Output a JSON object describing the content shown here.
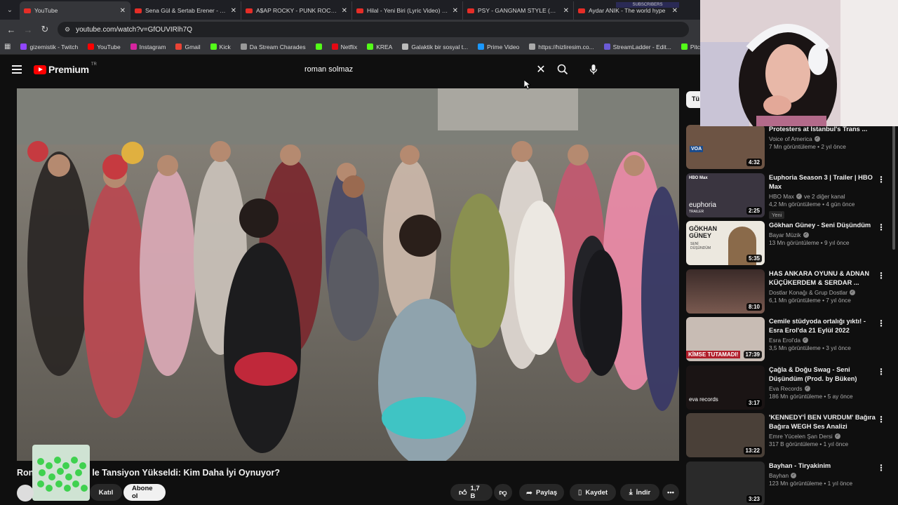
{
  "browser": {
    "tabs": [
      {
        "title": "YouTube",
        "active": true
      },
      {
        "title": "Sena Gül & Sertab Erener - Yed"
      },
      {
        "title": "A$AP ROCKY - PUNK ROCKY (V"
      },
      {
        "title": "Hilal - Yeni Biri (Lyric Video) - Y"
      },
      {
        "title": "PSY - GANGNAM STYLE (강남스"
      },
      {
        "title": "Aydar ANIK - The world hype"
      }
    ],
    "overlay_text": "SUBSCRIBERS",
    "url": "youtube.com/watch?v=GfOUVIRlh7Q",
    "bookmarks": [
      "gizemistik - Twitch",
      "YouTube",
      "Instagram",
      "Gmail",
      "Kick",
      "Da Stream Charades",
      "",
      "Netflix",
      "KREA",
      "Galaktik bir sosyal t...",
      "Prime Video",
      "https://hizliresim.co...",
      "StreamLadder - Edit...",
      "Pitch KICK"
    ]
  },
  "header": {
    "logo": "Premium",
    "logo_region": "TR",
    "search_query": "roman solmaz"
  },
  "video": {
    "title_visible_start": "Ron",
    "title_visible_end": "le Tansiyon Yükseldi: Kim Daha İyi Oynuyor?",
    "join_label": "Katıl",
    "subscribe_label": "Abone ol",
    "likes": "1,7 B",
    "share_label": "Paylaş",
    "save_label": "Kaydet",
    "download_label": "İndir"
  },
  "sidebar": {
    "chip": "Tü",
    "items": [
      {
        "title": "Protesters at Istanbul's Trans ...",
        "channel": "Voice of America",
        "views": "7 Mn görüntüleme • 2 yıl önce",
        "duration": "4:32",
        "thumb": "#5a4a3a"
      },
      {
        "title": "Euphoria Season 3 | Trailer | HBO Max",
        "channel": "HBO Max",
        "extra": "ve 2 diğer kanal",
        "views": "4,2 Mn görüntüleme • 4 gün önce",
        "badge": "Yeni",
        "duration": "2:25",
        "thumb": "#3a3540"
      },
      {
        "title": "Gökhan Güney - Seni Düşündüm",
        "channel": "Bayar Müzik",
        "views": "13 Mn görüntüleme • 9 yıl önce",
        "duration": "5:35",
        "thumb": "#e8e4dc"
      },
      {
        "title": "HAS ANKARA OYUNU & ADNAN KÜÇÜKERDEM & SERDAR ...",
        "channel": "Dostlar Konağı & Grup Dostlar",
        "views": "6,1 Mn görüntüleme • 7 yıl önce",
        "duration": "8:10",
        "thumb": "#6a5048"
      },
      {
        "title": "Cemile stüdyoda ortalığı yıktı! - Esra Erol'da 21 Eylül 2022",
        "channel": "Esra Erol'da",
        "views": "3,5 Mn görüntüleme • 3 yıl önce",
        "duration": "17:39",
        "thumb": "#b8a8a0"
      },
      {
        "title": "Çağla & Doğu Swag - Seni Düşündüm (Prod. by Büken)",
        "channel": "Eva Records",
        "views": "186 Mn görüntüleme • 5 ay önce",
        "duration": "3:17",
        "thumb": "#1a1414"
      },
      {
        "title": "'KENNEDY'İ BEN VURDUM' Bağıra Bağıra WEGH Ses Analizi",
        "channel": "Emre Yücelen Şan Dersi",
        "views": "317 B görüntüleme • 1 yıl önce",
        "duration": "13:22",
        "thumb": "#4a4038"
      },
      {
        "title": "Bayhan - Tiryakinim",
        "channel": "Bayhan",
        "views": "123 Mn görüntüleme • 1 yıl önce",
        "duration": "3:23",
        "thumb": "#2a2a2a"
      }
    ]
  },
  "thumb_texts": {
    "voa": "VOA",
    "hbo": "HBO Max",
    "euphoria": "euphoria",
    "trailer": "TRAILER",
    "gokhan": "GÖKHAN GÜNEY",
    "seni": "SENİ DÜŞÜNDÜM",
    "kimse": "KİMSE TUTAMADI!",
    "eva": "eva records"
  }
}
